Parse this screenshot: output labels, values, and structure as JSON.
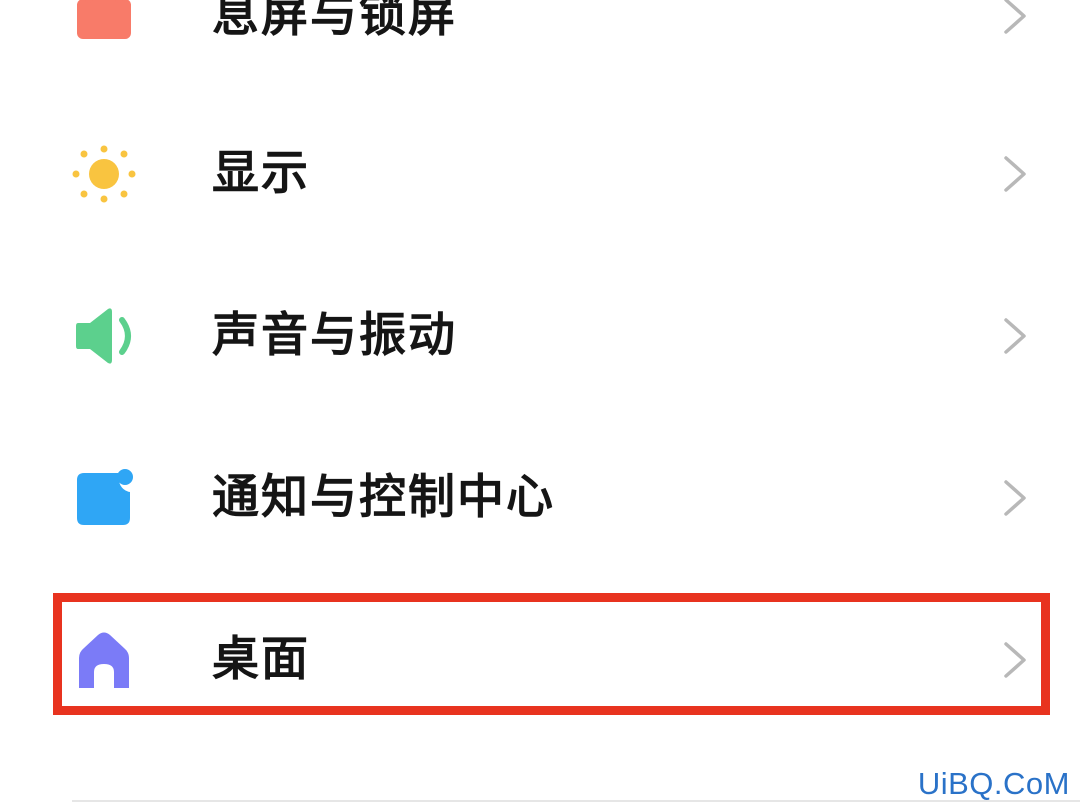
{
  "settings_list": {
    "items": [
      {
        "label": "息屏与锁屏",
        "icon": "lock-screen-icon",
        "icon_color": "#f87b69"
      },
      {
        "label": "显示",
        "icon": "sun-icon",
        "icon_color": "#f9c440"
      },
      {
        "label": "声音与振动",
        "icon": "speaker-icon",
        "icon_color": "#5cd08d"
      },
      {
        "label": "通知与控制中心",
        "icon": "notification-icon",
        "icon_color": "#2fa6f5"
      },
      {
        "label": "桌面",
        "icon": "home-icon",
        "icon_color": "#7b7bf7"
      }
    ]
  },
  "highlight": {
    "item": "桌面",
    "color": "#e8331f"
  },
  "watermark": "UiBQ.CoM"
}
